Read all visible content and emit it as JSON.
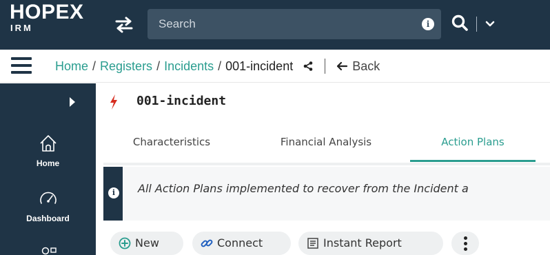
{
  "header": {
    "logo_main": "HOPEX",
    "logo_sub": "IRM",
    "search_placeholder": "Search",
    "icons": [
      "swap-icon",
      "info-icon",
      "search-icon",
      "chevron-down-icon"
    ],
    "background_color": "#1f3446",
    "search_box_color": "#3d5264"
  },
  "breadcrumb": {
    "items": [
      "Home",
      "Registers",
      "Incidents"
    ],
    "current": "001-incident",
    "back_label": "Back",
    "link_color": "#2a9d8f"
  },
  "sidebar": {
    "items": [
      {
        "label": "Home",
        "icon": "home-icon"
      },
      {
        "label": "Dashboard",
        "icon": "gauge-icon"
      },
      {
        "label": "",
        "icon": "users-icon"
      }
    ]
  },
  "object": {
    "title": "001-incident",
    "icon": "flash-icon",
    "icon_color": "#d62d20"
  },
  "tabs": [
    {
      "label": "Characteristics",
      "active": false
    },
    {
      "label": "Financial Analysis",
      "active": false
    },
    {
      "label": "Action Plans",
      "active": true
    }
  ],
  "alert": {
    "text": "All Action Plans implemented to recover from the Incident a"
  },
  "toolbar": {
    "new_label": "New",
    "connect_label": "Connect",
    "instant_report_label": "Instant Report",
    "accent_color": "#2a9d8f"
  }
}
